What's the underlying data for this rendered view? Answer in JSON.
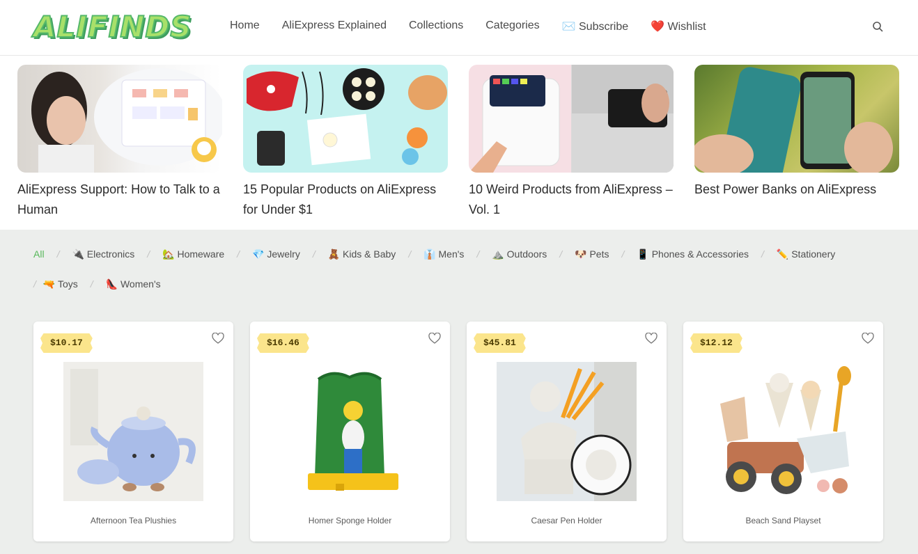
{
  "header": {
    "logo_text": "ALIFINDS",
    "nav": [
      {
        "label": "Home"
      },
      {
        "label": "AliExpress Explained"
      },
      {
        "label": "Collections"
      },
      {
        "label": "Categories"
      },
      {
        "label": "✉️ Subscribe"
      },
      {
        "label": "❤️ Wishlist"
      }
    ],
    "search_icon": "search-icon"
  },
  "articles": [
    {
      "title": "AliExpress Support: How to Talk to a Human"
    },
    {
      "title": "15 Popular Products on AliExpress for Under $1"
    },
    {
      "title": "10 Weird Products from AliExpress – Vol. 1"
    },
    {
      "title": "Best Power Banks on AliExpress"
    }
  ],
  "filters": {
    "row1": [
      "All",
      "🔌 Electronics",
      "🏡 Homeware",
      "💎 Jewelry",
      "🧸 Kids & Baby",
      "👔 Men's",
      "⛰️ Outdoors",
      "🐶 Pets",
      "📱 Phones & Accessories",
      "✏️ Stationery"
    ],
    "row2": [
      "🔫 Toys",
      "👠 Women's"
    ],
    "separator": "/"
  },
  "products": [
    {
      "price": "$10.17",
      "name": "Afternoon Tea Plushies"
    },
    {
      "price": "$16.46",
      "name": "Homer Sponge Holder"
    },
    {
      "price": "$45.81",
      "name": "Caesar Pen Holder"
    },
    {
      "price": "$12.12",
      "name": "Beach Sand Playset"
    }
  ],
  "colors": {
    "accent": "#57b85a",
    "price_tag": "#fbe58c",
    "section_bg": "#eceeec"
  }
}
